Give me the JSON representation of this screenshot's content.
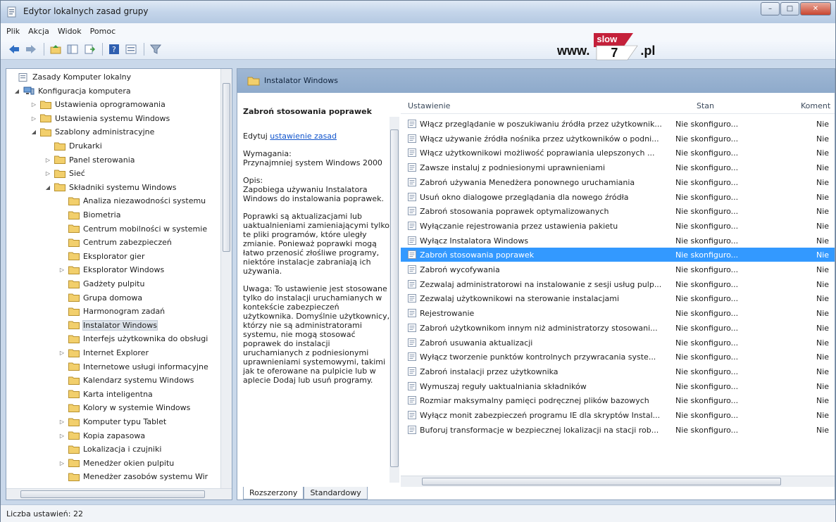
{
  "window": {
    "title": "Edytor lokalnych zasad grupy",
    "controls": {
      "minimize": "–",
      "maximize": "□",
      "close": "✕"
    }
  },
  "menu": [
    "Plik",
    "Akcja",
    "Widok",
    "Pomoc"
  ],
  "logo": {
    "www": "www.",
    "flag_top": "slow",
    "flag_num": "7",
    "pl": ".pl"
  },
  "tree": {
    "items": [
      {
        "label": "Zasady Komputer lokalny",
        "level": 0,
        "exp": "",
        "icon": "policy"
      },
      {
        "label": "Konfiguracja komputera",
        "level": 0,
        "exp": "◢",
        "icon": "computer"
      },
      {
        "label": "Ustawienia oprogramowania",
        "level": 1,
        "exp": "▷",
        "icon": "folder"
      },
      {
        "label": "Ustawienia systemu Windows",
        "level": 1,
        "exp": "▷",
        "icon": "folder"
      },
      {
        "label": "Szablony administracyjne",
        "level": 1,
        "exp": "◢",
        "icon": "folder"
      },
      {
        "label": "Drukarki",
        "level": 2,
        "exp": "",
        "icon": "folder"
      },
      {
        "label": "Panel sterowania",
        "level": 2,
        "exp": "▷",
        "icon": "folder"
      },
      {
        "label": "Sieć",
        "level": 2,
        "exp": "▷",
        "icon": "folder"
      },
      {
        "label": "Składniki systemu Windows",
        "level": 2,
        "exp": "◢",
        "icon": "folder"
      },
      {
        "label": "Analiza niezawodności systemu",
        "level": 3,
        "exp": "",
        "icon": "folder"
      },
      {
        "label": "Biometria",
        "level": 3,
        "exp": "",
        "icon": "folder"
      },
      {
        "label": "Centrum mobilności w systemie",
        "level": 3,
        "exp": "",
        "icon": "folder"
      },
      {
        "label": "Centrum zabezpieczeń",
        "level": 3,
        "exp": "",
        "icon": "folder"
      },
      {
        "label": "Eksplorator gier",
        "level": 3,
        "exp": "",
        "icon": "folder"
      },
      {
        "label": "Eksplorator Windows",
        "level": 3,
        "exp": "▷",
        "icon": "folder"
      },
      {
        "label": "Gadżety pulpitu",
        "level": 3,
        "exp": "",
        "icon": "folder"
      },
      {
        "label": "Grupa domowa",
        "level": 3,
        "exp": "",
        "icon": "folder"
      },
      {
        "label": "Harmonogram zadań",
        "level": 3,
        "exp": "",
        "icon": "folder"
      },
      {
        "label": "Instalator Windows",
        "level": 3,
        "exp": "",
        "icon": "folder",
        "selected": true
      },
      {
        "label": "Interfejs użytkownika do obsługi",
        "level": 3,
        "exp": "",
        "icon": "folder"
      },
      {
        "label": "Internet Explorer",
        "level": 3,
        "exp": "▷",
        "icon": "folder"
      },
      {
        "label": "Internetowe usługi informacyjne",
        "level": 3,
        "exp": "",
        "icon": "folder"
      },
      {
        "label": "Kalendarz systemu Windows",
        "level": 3,
        "exp": "",
        "icon": "folder"
      },
      {
        "label": "Karta inteligentna",
        "level": 3,
        "exp": "",
        "icon": "folder"
      },
      {
        "label": "Kolory w systemie Windows",
        "level": 3,
        "exp": "",
        "icon": "folder"
      },
      {
        "label": "Komputer typu Tablet",
        "level": 3,
        "exp": "▷",
        "icon": "folder"
      },
      {
        "label": "Kopia zapasowa",
        "level": 3,
        "exp": "▷",
        "icon": "folder"
      },
      {
        "label": "Lokalizacja i czujniki",
        "level": 3,
        "exp": "",
        "icon": "folder"
      },
      {
        "label": "Menedżer okien pulpitu",
        "level": 3,
        "exp": "▷",
        "icon": "folder"
      },
      {
        "label": "Menedżer zasobów systemu Wir",
        "level": 3,
        "exp": "",
        "icon": "folder"
      }
    ]
  },
  "right": {
    "header": "Instalator Windows",
    "description": {
      "title": "Zabroń stosowania poprawek",
      "edit_prefix": "Edytuj ",
      "edit_link": "ustawienie zasad",
      "req_label": "Wymagania:",
      "req_text": "Przynajmniej system Windows 2000",
      "desc_label": "Opis:",
      "desc_text": "Zapobiega używaniu Instalatora Windows do instalowania poprawek.",
      "desc_para2": "Poprawki są aktualizacjami lub uaktualnieniami zamieniającymi tylko te pliki programów, które uległy zmianie. Ponieważ poprawki mogą łatwo przenosić złośliwe programy, niektóre instalacje zabraniają ich używania.",
      "note": "Uwaga: To ustawienie jest stosowane tylko do instalacji uruchamianych w kontekście zabezpieczeń użytkownika. Domyślnie użytkownicy, którzy nie są administratorami systemu, nie mogą stosować poprawek do instalacji uruchamianych z podniesionymi uprawnieniami systemowymi, takimi jak te oferowane na pulpicie lub w aplecie Dodaj lub usuń programy."
    },
    "columns": {
      "setting": "Ustawienie",
      "state": "Stan",
      "comment": "Koment"
    },
    "rows": [
      {
        "name": "Włącz przeglądanie w poszukiwaniu źródła przez użytkownik...",
        "state": "Nie skonfiguro...",
        "comment": "Nie"
      },
      {
        "name": "Włącz używanie źródła nośnika przez użytkowników o podni...",
        "state": "Nie skonfiguro...",
        "comment": "Nie"
      },
      {
        "name": "Włącz użytkownikowi możliwość poprawiania ulepszonych ...",
        "state": "Nie skonfiguro...",
        "comment": "Nie"
      },
      {
        "name": "Zawsze instaluj z podniesionymi uprawnieniami",
        "state": "Nie skonfiguro...",
        "comment": "Nie"
      },
      {
        "name": "Zabroń używania Menedżera ponownego uruchamiania",
        "state": "Nie skonfiguro...",
        "comment": "Nie"
      },
      {
        "name": "Usuń okno dialogowe przeglądania dla nowego źródła",
        "state": "Nie skonfiguro...",
        "comment": "Nie"
      },
      {
        "name": "Zabroń stosowania poprawek optymalizowanych",
        "state": "Nie skonfiguro...",
        "comment": "Nie"
      },
      {
        "name": "Wyłączanie rejestrowania przez ustawienia pakietu",
        "state": "Nie skonfiguro...",
        "comment": "Nie"
      },
      {
        "name": "Wyłącz Instalatora Windows",
        "state": "Nie skonfiguro...",
        "comment": "Nie"
      },
      {
        "name": "Zabroń stosowania poprawek",
        "state": "Nie skonfiguro...",
        "comment": "Nie",
        "selected": true
      },
      {
        "name": "Zabroń wycofywania",
        "state": "Nie skonfiguro...",
        "comment": "Nie"
      },
      {
        "name": "Zezwalaj administratorowi na instalowanie z sesji usług pulp...",
        "state": "Nie skonfiguro...",
        "comment": "Nie"
      },
      {
        "name": "Zezwalaj użytkownikowi na sterowanie instalacjami",
        "state": "Nie skonfiguro...",
        "comment": "Nie"
      },
      {
        "name": "Rejestrowanie",
        "state": "Nie skonfiguro...",
        "comment": "Nie"
      },
      {
        "name": "Zabroń użytkownikom innym niż administratorzy stosowani...",
        "state": "Nie skonfiguro...",
        "comment": "Nie"
      },
      {
        "name": "Zabroń usuwania aktualizacji",
        "state": "Nie skonfiguro...",
        "comment": "Nie"
      },
      {
        "name": "Wyłącz tworzenie punktów kontrolnych przywracania syste...",
        "state": "Nie skonfiguro...",
        "comment": "Nie"
      },
      {
        "name": "Zabroń instalacji przez użytkownika",
        "state": "Nie skonfiguro...",
        "comment": "Nie"
      },
      {
        "name": "Wymuszaj reguły uaktualniania składników",
        "state": "Nie skonfiguro...",
        "comment": "Nie"
      },
      {
        "name": "Rozmiar maksymalny pamięci podręcznej plików bazowych",
        "state": "Nie skonfiguro...",
        "comment": "Nie"
      },
      {
        "name": "Wyłącz monit zabezpieczeń programu IE dla skryptów Instal...",
        "state": "Nie skonfiguro...",
        "comment": "Nie"
      },
      {
        "name": "Buforuj transformacje w bezpiecznej lokalizacji na stacji rob...",
        "state": "Nie skonfiguro...",
        "comment": "Nie"
      }
    ],
    "tabs": [
      "Rozszerzony",
      "Standardowy"
    ]
  },
  "status": "Liczba ustawień: 22",
  "colors": {
    "selection": "#3399ff",
    "folder": "#f2cf6c",
    "header_bg": "#9fb7d4"
  }
}
